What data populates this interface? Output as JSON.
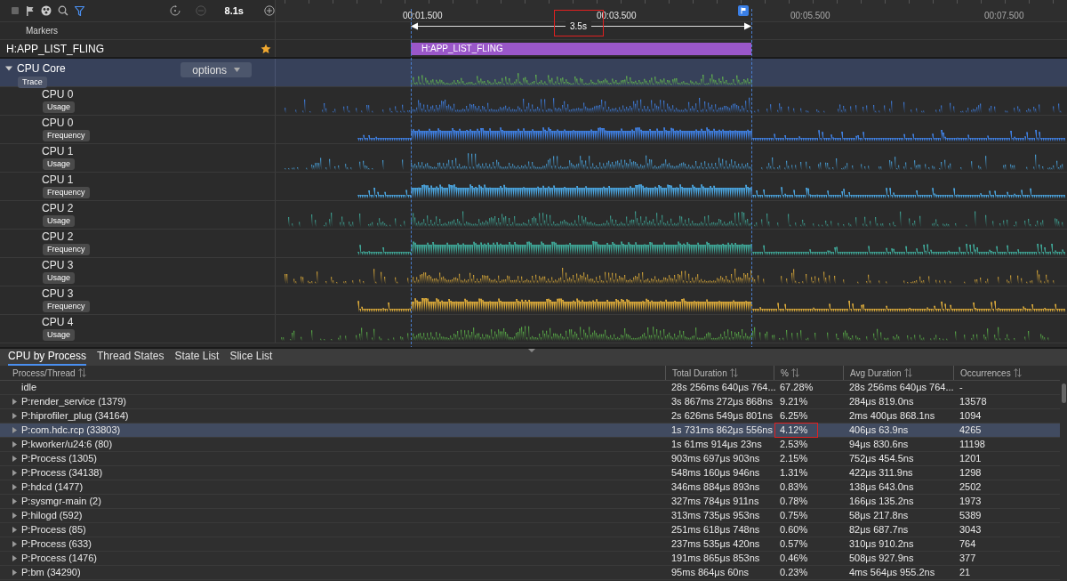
{
  "toolbar": {
    "zoom": "8.1s"
  },
  "ruler": {
    "ticks": [
      "00:01.500",
      "00:03.500",
      "00:05.500",
      "00:07.500"
    ],
    "duration": "3.5s",
    "duration_boxed": true
  },
  "markers": {
    "title": "Markers"
  },
  "marker_row": {
    "label": "H:APP_LIST_FLING",
    "starred": true,
    "slice": "H:APP_LIST_FLING"
  },
  "cpu_core": {
    "title": "CPU Core",
    "tag": "Trace",
    "expanded": true,
    "options": "options"
  },
  "tracks": [
    {
      "cpu": "CPU 0",
      "tag": "Usage",
      "kind": "usage",
      "color": "#3f7fe0"
    },
    {
      "cpu": "CPU 0",
      "tag": "Frequency",
      "kind": "frequency",
      "color": "#3f7fe0"
    },
    {
      "cpu": "CPU 1",
      "tag": "Usage",
      "kind": "usage",
      "color": "#4aa3dc"
    },
    {
      "cpu": "CPU 1",
      "tag": "Frequency",
      "kind": "frequency",
      "color": "#4aa3dc"
    },
    {
      "cpu": "CPU 2",
      "tag": "Usage",
      "kind": "usage",
      "color": "#3fa596"
    },
    {
      "cpu": "CPU 2",
      "tag": "Frequency",
      "kind": "frequency",
      "color": "#3fa596"
    },
    {
      "cpu": "CPU 3",
      "tag": "Usage",
      "kind": "usage",
      "color": "#d8a83a"
    },
    {
      "cpu": "CPU 3",
      "tag": "Frequency",
      "kind": "frequency",
      "color": "#d8a83a"
    },
    {
      "cpu": "CPU 4",
      "tag": "Usage",
      "kind": "usage",
      "color": "#5bb04a"
    }
  ],
  "bottom_tabs": [
    {
      "label": "CPU by Process",
      "selected": true
    },
    {
      "label": "Thread States",
      "selected": false
    },
    {
      "label": "State List",
      "selected": false
    },
    {
      "label": "Slice List",
      "selected": false
    }
  ],
  "table": {
    "columns": [
      "Process/Thread",
      "Total Duration",
      "%",
      "Avg Duration",
      "Occurrences"
    ],
    "rows": [
      {
        "name": "idle",
        "expandable": false,
        "total": "28s 256ms 640μs 764...",
        "percent": "67.28%",
        "avg": "28s 256ms 640μs 764...",
        "occurrences": "-",
        "selected": false,
        "boxed": false
      },
      {
        "name": "P:render_service (1379)",
        "expandable": true,
        "total": "3s 867ms 272μs 868ns",
        "percent": "9.21%",
        "avg": "284μs 819.0ns",
        "occurrences": "13578",
        "selected": false,
        "boxed": false
      },
      {
        "name": "P:hiprofiler_plug (34164)",
        "expandable": true,
        "total": "2s 626ms 549μs 801ns",
        "percent": "6.25%",
        "avg": "2ms 400μs 868.1ns",
        "occurrences": "1094",
        "selected": false,
        "boxed": false
      },
      {
        "name": "P:com.hdc.rcp (33803)",
        "expandable": true,
        "total": "1s 731ms 862μs 556ns",
        "percent": "4.12%",
        "avg": "406μs 63.9ns",
        "occurrences": "4265",
        "selected": true,
        "boxed": true
      },
      {
        "name": "P:kworker/u24:6 (80)",
        "expandable": true,
        "total": "1s 61ms 914μs 23ns",
        "percent": "2.53%",
        "avg": "94μs 830.6ns",
        "occurrences": "11198",
        "selected": false,
        "boxed": false
      },
      {
        "name": "P:Process (1305)",
        "expandable": true,
        "total": "903ms 697μs 903ns",
        "percent": "2.15%",
        "avg": "752μs 454.5ns",
        "occurrences": "1201",
        "selected": false,
        "boxed": false
      },
      {
        "name": "P:Process (34138)",
        "expandable": true,
        "total": "548ms 160μs 946ns",
        "percent": "1.31%",
        "avg": "422μs 311.9ns",
        "occurrences": "1298",
        "selected": false,
        "boxed": false
      },
      {
        "name": "P:hdcd (1477)",
        "expandable": true,
        "total": "346ms 884μs 893ns",
        "percent": "0.83%",
        "avg": "138μs 643.0ns",
        "occurrences": "2502",
        "selected": false,
        "boxed": false
      },
      {
        "name": "P:sysmgr-main (2)",
        "expandable": true,
        "total": "327ms 784μs 911ns",
        "percent": "0.78%",
        "avg": "166μs 135.2ns",
        "occurrences": "1973",
        "selected": false,
        "boxed": false
      },
      {
        "name": "P:hilogd (592)",
        "expandable": true,
        "total": "313ms 735μs 953ns",
        "percent": "0.75%",
        "avg": "58μs 217.8ns",
        "occurrences": "5389",
        "selected": false,
        "boxed": false
      },
      {
        "name": "P:Process (85)",
        "expandable": true,
        "total": "251ms 618μs 748ns",
        "percent": "0.60%",
        "avg": "82μs 687.7ns",
        "occurrences": "3043",
        "selected": false,
        "boxed": false
      },
      {
        "name": "P:Process (633)",
        "expandable": true,
        "total": "237ms 535μs 420ns",
        "percent": "0.57%",
        "avg": "310μs 910.2ns",
        "occurrences": "764",
        "selected": false,
        "boxed": false
      },
      {
        "name": "P:Process (1476)",
        "expandable": true,
        "total": "191ms 865μs 853ns",
        "percent": "0.46%",
        "avg": "508μs 927.9ns",
        "occurrences": "377",
        "selected": false,
        "boxed": false
      },
      {
        "name": "P:bm (34290)",
        "expandable": true,
        "total": "95ms 864μs 60ns",
        "percent": "0.23%",
        "avg": "4ms 564μs 955.2ns",
        "occurrences": "21",
        "selected": false,
        "boxed": false
      }
    ]
  }
}
